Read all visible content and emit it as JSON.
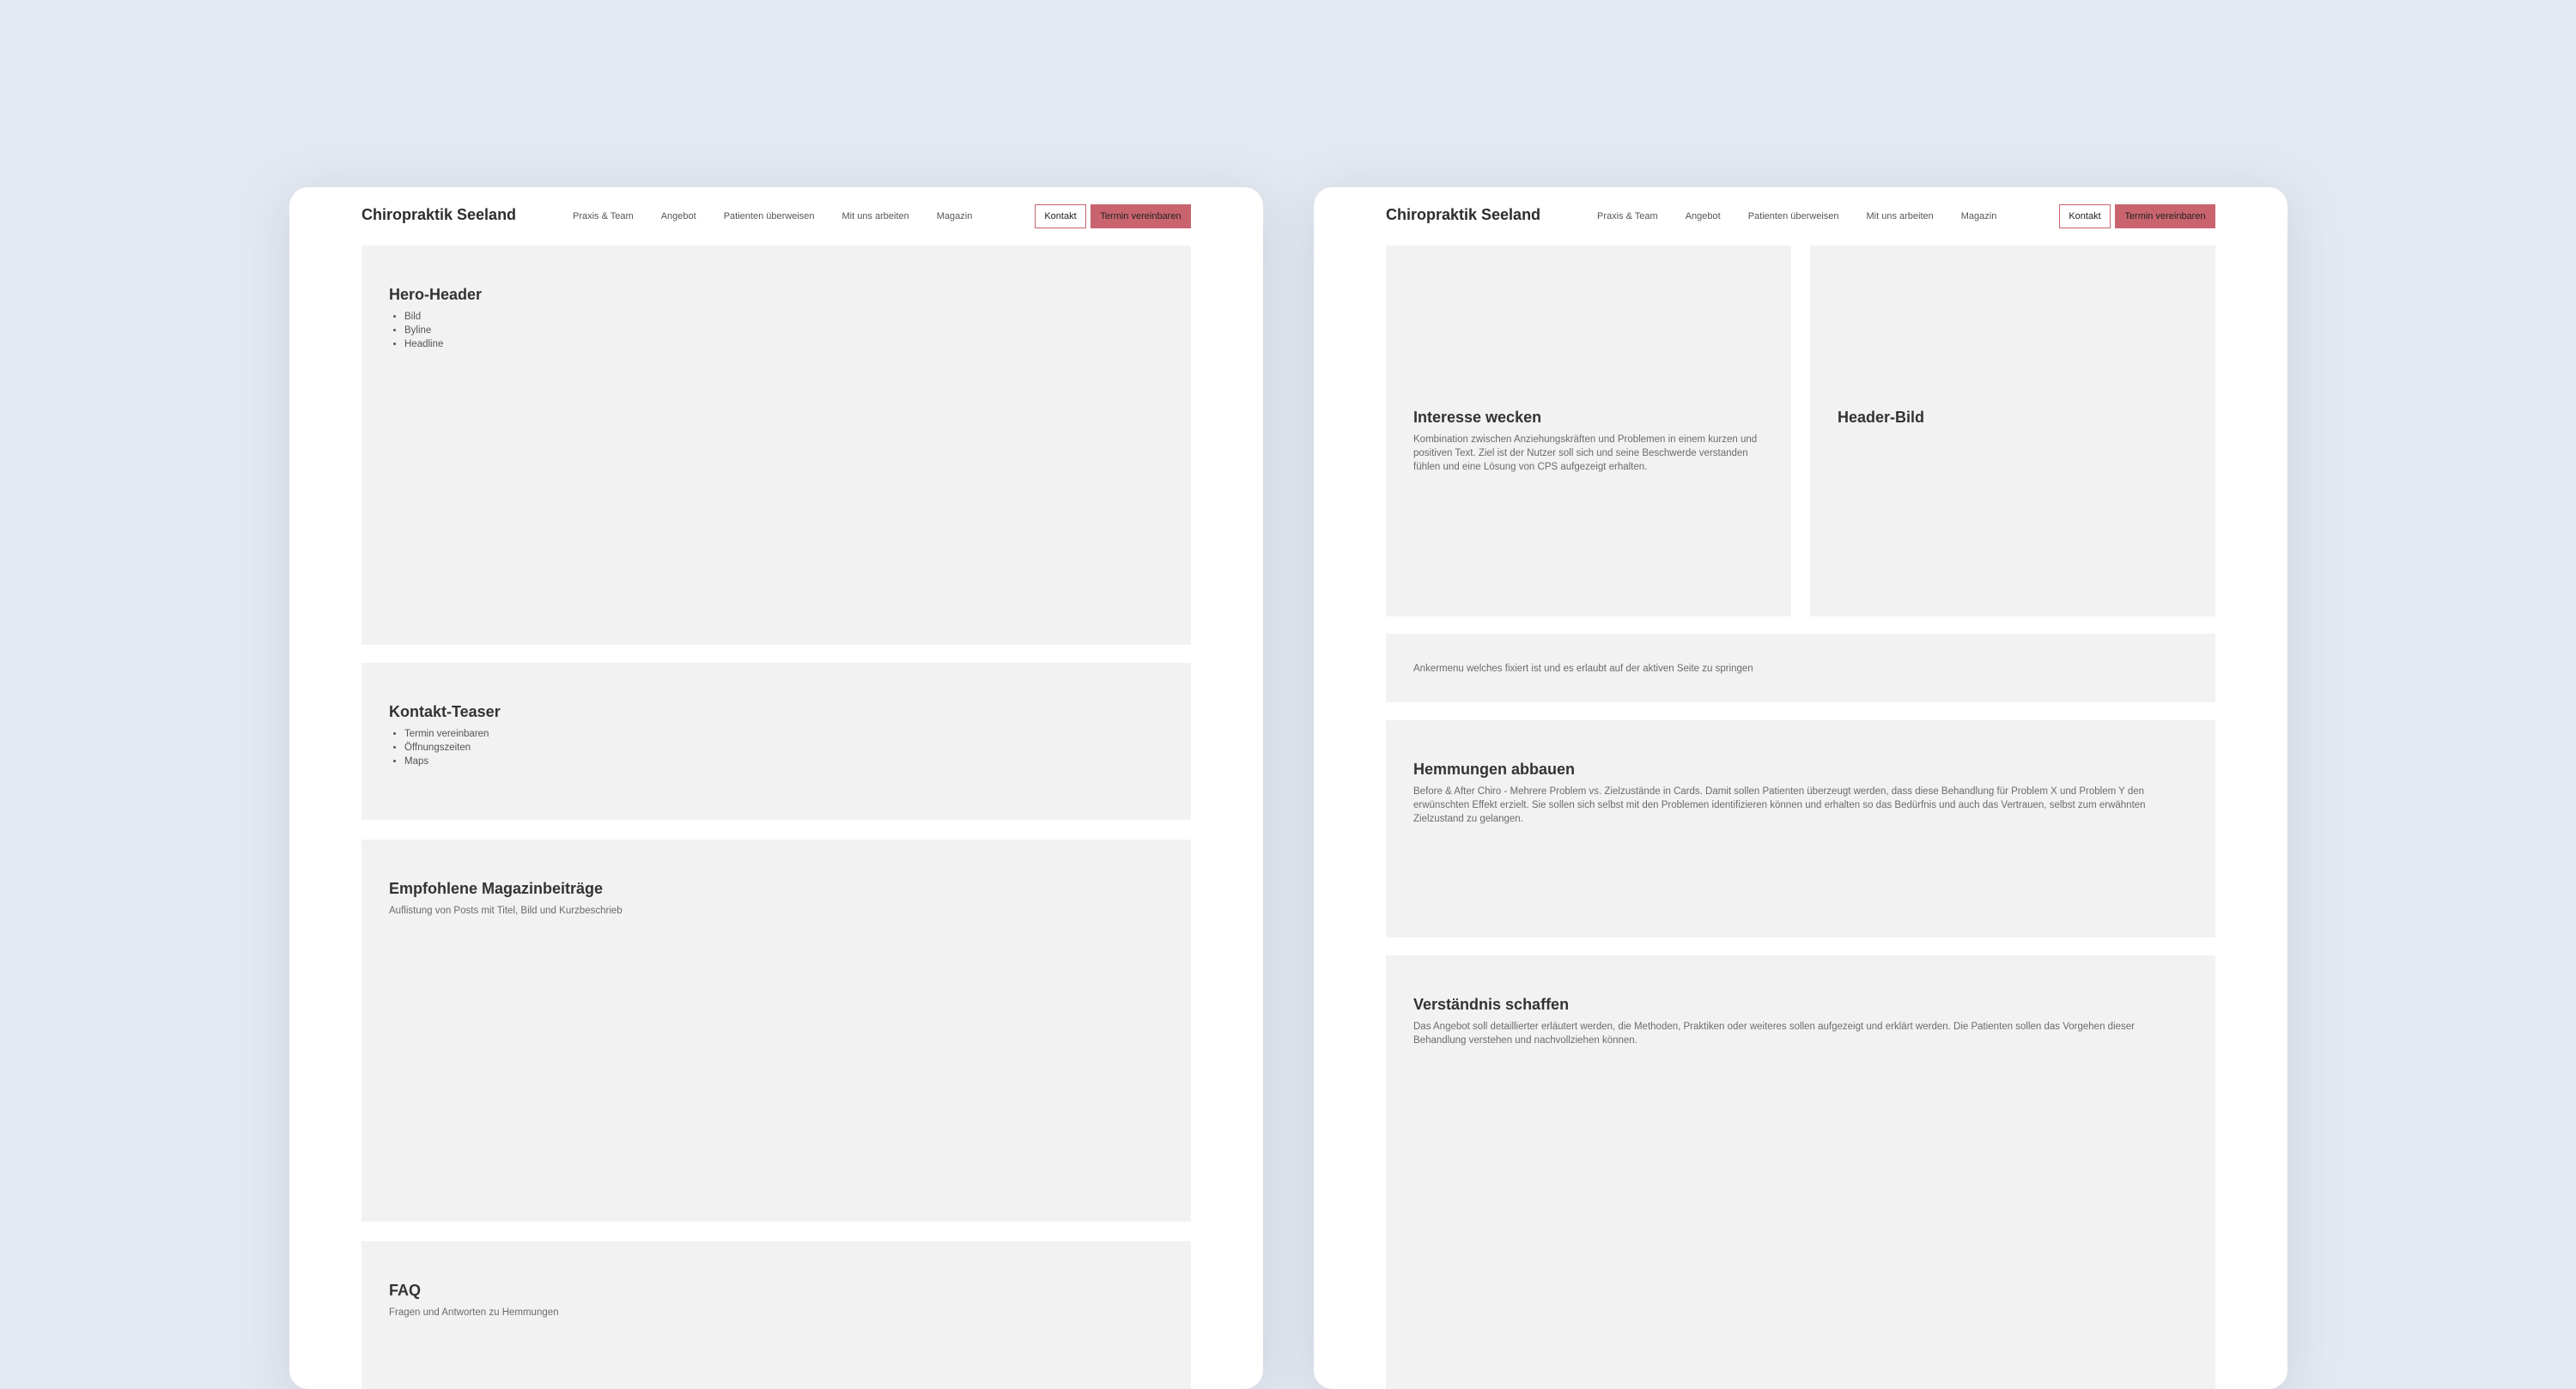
{
  "brand": "Chiropraktik Seeland",
  "nav": {
    "links": [
      "Praxis & Team",
      "Angebot",
      "Patienten überweisen",
      "Mit uns arbeiten",
      "Magazin"
    ],
    "kontakt": "Kontakt",
    "termin": "Termin vereinbaren"
  },
  "colors": {
    "background": "#e3e9f0",
    "accent": "#c9646f",
    "block": "#f2f2f2"
  },
  "left": {
    "hero": {
      "title": "Hero-Header",
      "items": [
        "Bild",
        "Byline",
        "Headline"
      ]
    },
    "kontakt": {
      "title": "Kontakt-Teaser",
      "items": [
        "Termin vereinbaren",
        "Öffnungszeiten",
        "Maps"
      ]
    },
    "magazin": {
      "title": "Empfohlene Magazinbeiträge",
      "text": "Auflistung von Posts mit Titel, Bild und Kurzbeschrieb"
    },
    "faq": {
      "title": "FAQ",
      "text": "Fragen und Antworten zu Hemmungen"
    }
  },
  "right": {
    "interesse": {
      "title": "Interesse wecken",
      "text": "Kombination zwischen Anziehungskräften und Problemen in einem kurzen und positiven Text. Ziel ist der Nutzer soll sich und seine Beschwerde verstanden fühlen und eine Lösung von CPS aufgezeigt erhalten."
    },
    "headerbild": {
      "title": "Header-Bild"
    },
    "anker": {
      "text": "Ankermenu welches fixiert ist und es erlaubt auf der aktiven Seite zu springen"
    },
    "hemmungen": {
      "title": "Hemmungen abbauen",
      "text": "Before & After Chiro - Mehrere Problem vs. Zielzustände in Cards. Damit sollen Patienten überzeugt werden, dass diese Behandlung für Problem X und Problem Y den erwünschten Effekt erzielt. Sie sollen sich selbst mit den Problemen identifizieren können und erhalten so das Bedürfnis und auch das Vertrauen, selbst zum erwähnten Zielzustand zu gelangen."
    },
    "verstaendnis": {
      "title": "Verständnis schaffen",
      "text": "Das Angebot soll detaillierter erläutert werden, die Methoden, Praktiken oder weiteres sollen aufgezeigt und erklärt werden. Die Patienten sollen das Vorgehen dieser Behandlung verstehen und nachvollziehen können."
    }
  }
}
